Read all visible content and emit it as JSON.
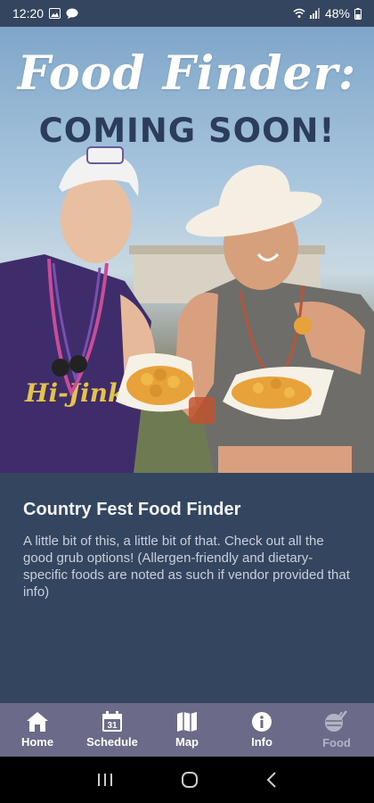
{
  "status": {
    "time": "12:20",
    "battery": "48%"
  },
  "hero": {
    "title": "Food Finder:",
    "subtitle": "COMING SOON!",
    "shirt_text": "Hi-Jinks"
  },
  "content": {
    "heading": "Country Fest Food Finder",
    "body": "A little bit of this, a little bit of that. Check out all the good grub options! (Allergen-friendly and dietary-specific foods are noted as such if vendor provided that info)"
  },
  "nav": {
    "items": [
      {
        "label": "Home",
        "icon": "home-icon"
      },
      {
        "label": "Schedule",
        "icon": "calendar-icon",
        "calendar_day": "31"
      },
      {
        "label": "Map",
        "icon": "map-icon"
      },
      {
        "label": "Info",
        "icon": "info-icon"
      },
      {
        "label": "Food",
        "icon": "food-icon"
      }
    ],
    "active": "Food"
  },
  "colors": {
    "header": "#34465f",
    "nav_bg": "#6b6a89",
    "title_text": "#2b3d5a"
  }
}
